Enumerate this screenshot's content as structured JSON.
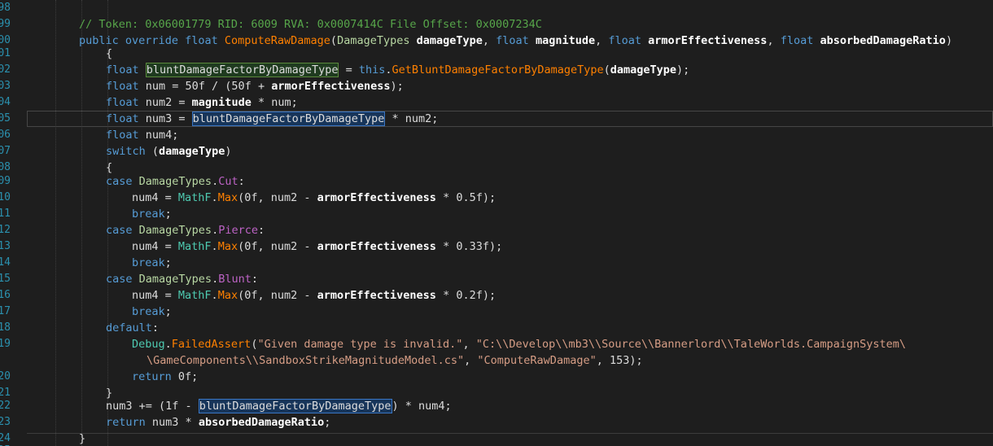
{
  "gutter": {
    "line_numbers": [
      "98",
      "99",
      "00",
      "01",
      "02",
      "03",
      "04",
      "05",
      "06",
      "07",
      "08",
      "09",
      "10",
      "11",
      "12",
      "13",
      "14",
      "15",
      "16",
      "17",
      "18",
      "19",
      "",
      "20",
      "21",
      "22",
      "23",
      "24",
      "25"
    ]
  },
  "code": {
    "comment": "// Token: 0x06001779 RID: 6009 RVA: 0x0007414C File Offset: 0x0007234C",
    "kw_public": "public",
    "kw_override": "override",
    "kw_float": "float",
    "kw_this": "this",
    "kw_switch": "switch",
    "kw_case": "case",
    "kw_break": "break",
    "kw_default": "default",
    "kw_return": "return",
    "method_name": "ComputeRawDamage",
    "type_damage": "DamageTypes",
    "param_damage_type": "damageType",
    "param_magnitude": "magnitude",
    "param_armor": "armorEffectiveness",
    "param_absorbed": "absorbedDamageRatio",
    "var_blunt": "bluntDamageFactorByDamageType",
    "method_get_blunt": "GetBluntDamageFactorByDamageType",
    "cls_mathf": "MathF",
    "method_max": "Max",
    "enum_cut": "Cut",
    "enum_pierce": "Pierce",
    "enum_blunt": "Blunt",
    "cls_debug": "Debug",
    "method_failed_assert": "FailedAssert",
    "str_message": "\"Given damage type is invalid.\"",
    "str_path_1": "\"C:\\\\Develop\\\\mb3\\\\Source\\\\Bannerlord\\\\TaleWorlds.CampaignSystem\\",
    "str_path_2": "\\GameComponents\\\\SandboxStrikeMagnitudeModel.cs\"",
    "str_method": "\"ComputeRawDamage\""
  }
}
